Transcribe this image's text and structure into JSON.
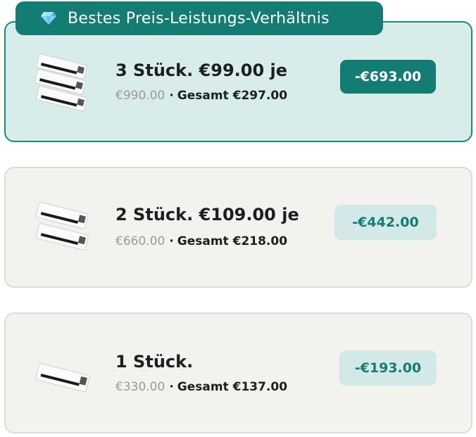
{
  "badge": {
    "icon": "diamond-icon",
    "label": "Bestes Preis-Leistungs-Verhältnis",
    "color": "#137d74"
  },
  "options": [
    {
      "title": "3 Stück. €99.00 je",
      "old_price": "€990.00",
      "separator": "·",
      "total": "Gesamt €297.00",
      "savings": "-€693.00",
      "quantity": 3,
      "selected": true
    },
    {
      "title": "2 Stück. €109.00 je",
      "old_price": "€660.00",
      "separator": "·",
      "total": "Gesamt €218.00",
      "savings": "-€442.00",
      "quantity": 2,
      "selected": false
    },
    {
      "title": "1 Stück.",
      "old_price": "€330.00",
      "separator": "·",
      "total": "Gesamt €137.00",
      "savings": "-€193.00",
      "quantity": 1,
      "selected": false
    }
  ],
  "colors": {
    "accent": "#137d74",
    "selected_bg": "#d8ecea",
    "card_bg": "#f2f2ee",
    "savings_light_bg": "#d3e9e7"
  }
}
